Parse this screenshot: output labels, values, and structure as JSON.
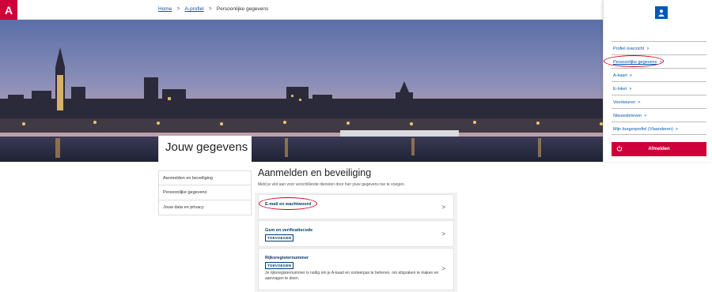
{
  "logo": {
    "mark": "A"
  },
  "breadcrumb": {
    "items": [
      "Home",
      "A-profiel"
    ],
    "current": "Persoonlijke gegevens",
    "sep": ">"
  },
  "hero": {
    "title": "Jouw gegevens"
  },
  "leftmenu": {
    "items": [
      "Aanmelden en beveiliging",
      "Persoonlijke gegevens",
      "Jouw data en privacy"
    ]
  },
  "main": {
    "heading": "Aanmelden en beveiliging",
    "subtitle": "Meld je vlot aan voor verschillende diensten door hier jouw gegevens toe te voegen.",
    "cards": [
      {
        "title": "E-mail en wachtwoord"
      },
      {
        "title": "Gsm en verificatiecode",
        "tag": "TOEVOEGEN"
      },
      {
        "title": "Rijksregisternummer",
        "tag": "TOEVOEGEN",
        "desc": "Je rijksregisternummer is nodig om je A-kaart en sorteerpas te beheren, om afspraken te maken en aanvragen te doen."
      }
    ],
    "chevron": ">"
  },
  "panel": {
    "items": [
      "Profiel overzicht",
      "Persoonlijke gegevens",
      "A-kaart",
      "E-loket",
      "Voorkeuren",
      "Nieuwsbrieven",
      "Mijn burgerprofiel (Vlaanderen)"
    ],
    "chevron": ">",
    "logout": "Afmelden"
  },
  "colors": {
    "brand": "#cf0039",
    "link": "#0057b7",
    "highlight": "#d0021b"
  }
}
